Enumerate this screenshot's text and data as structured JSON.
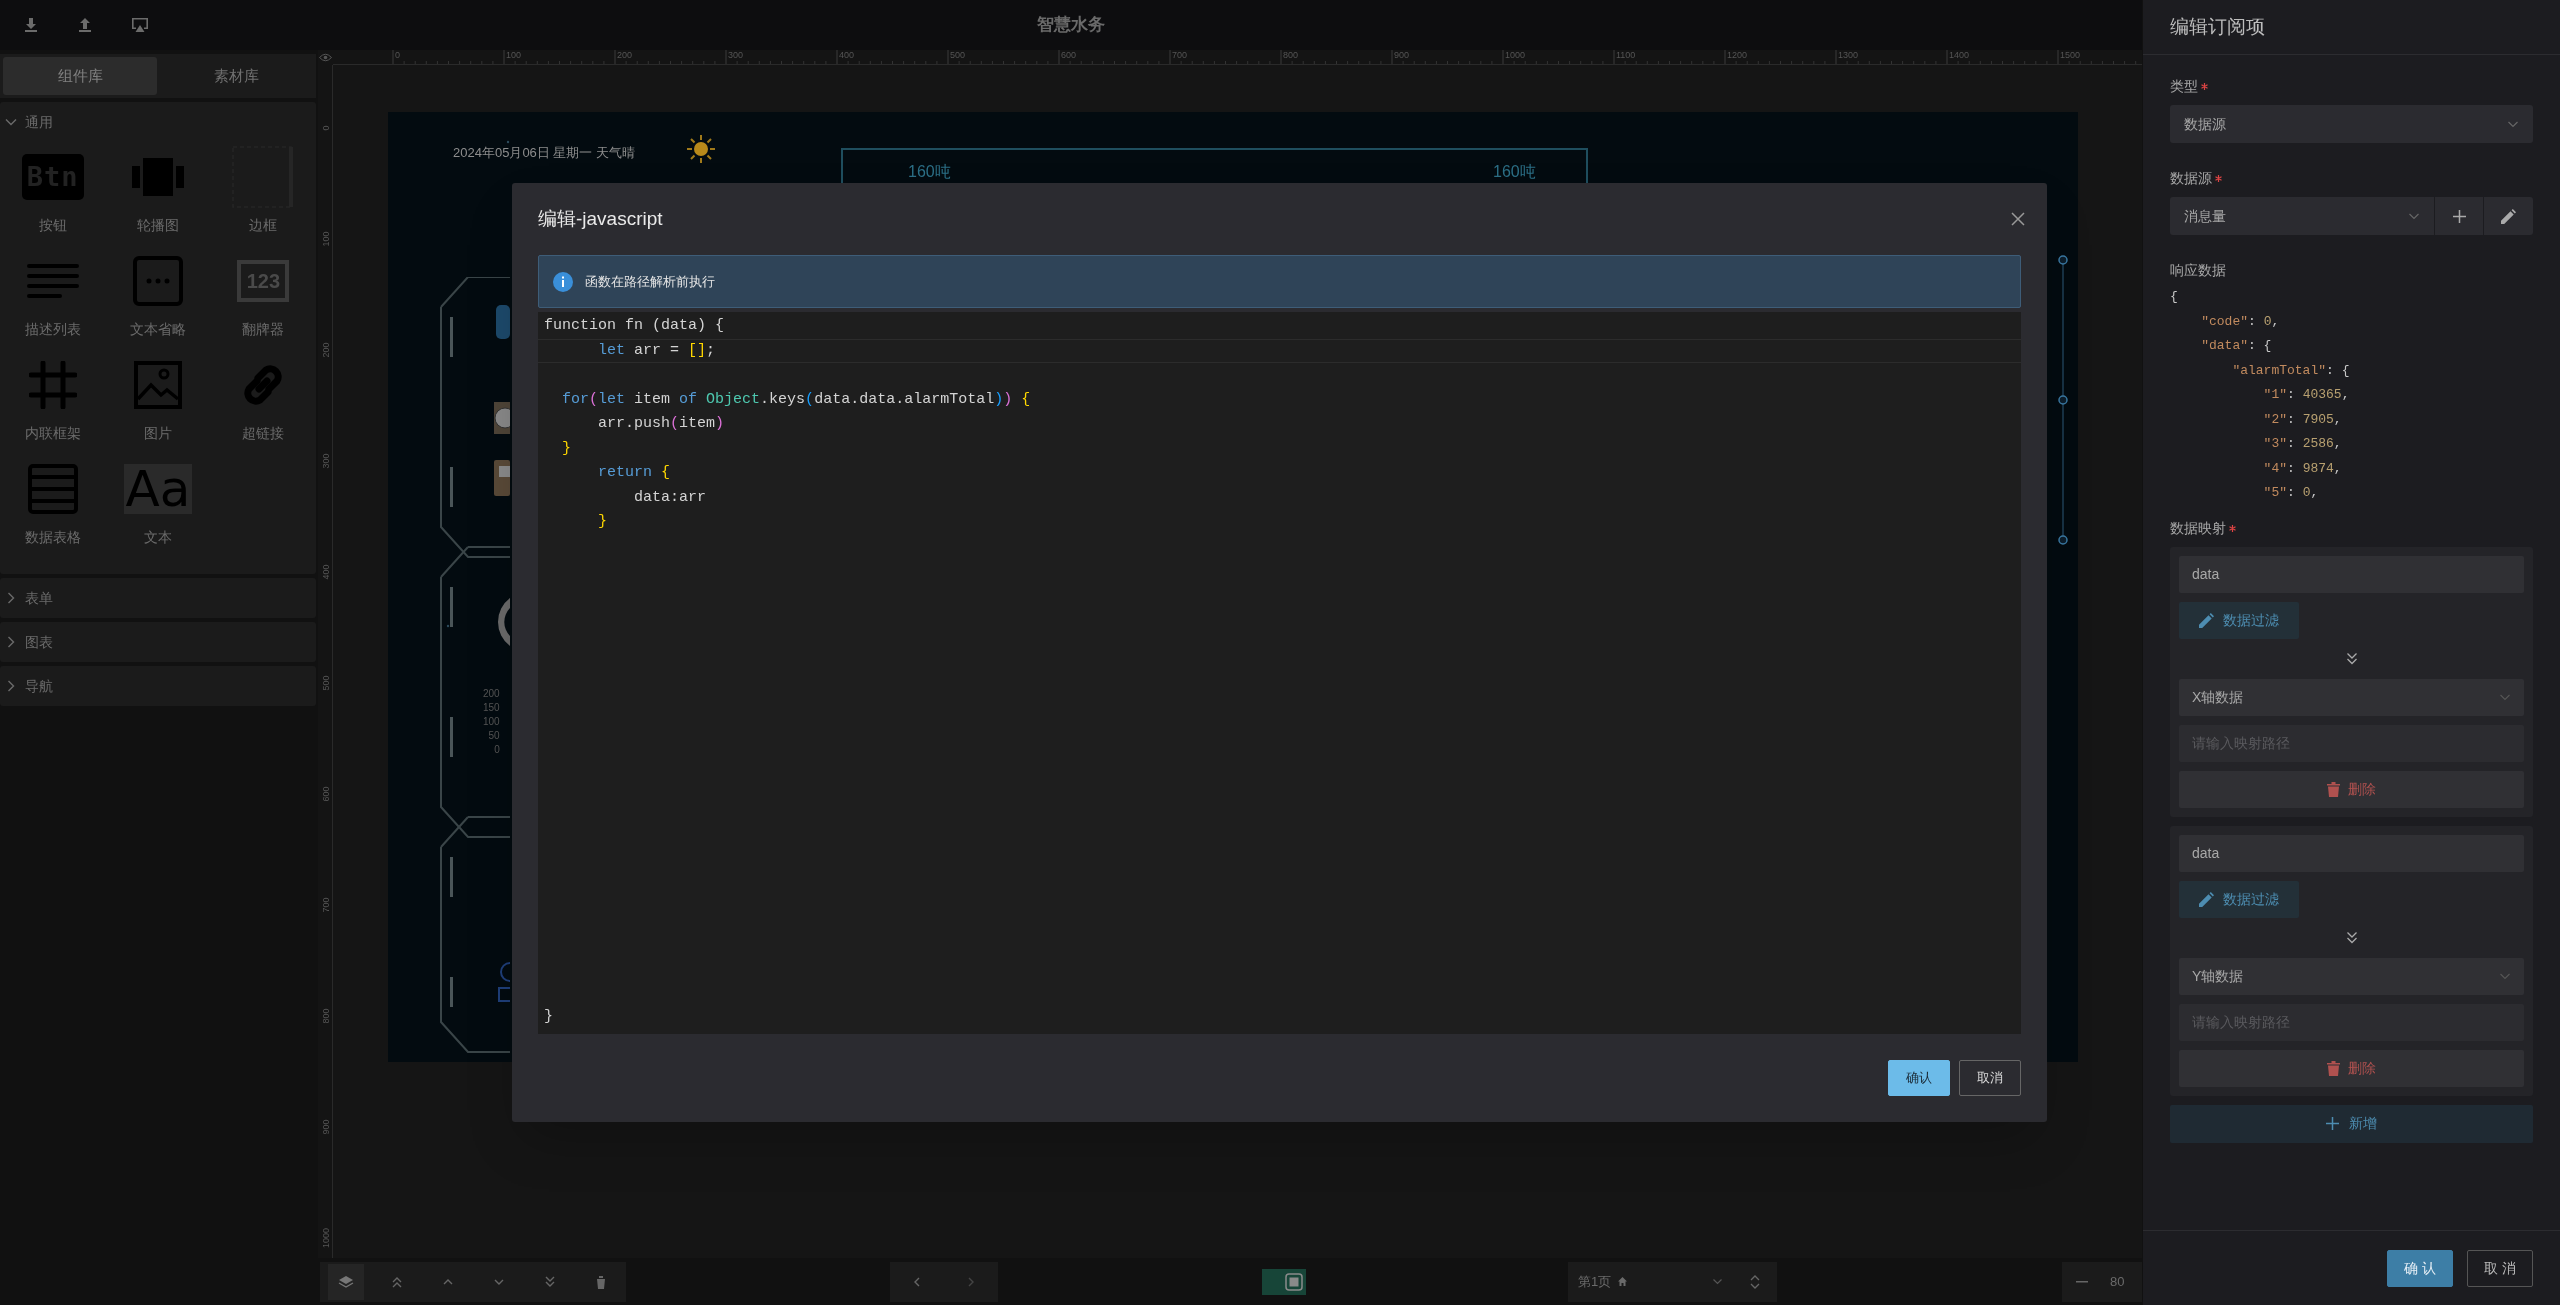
{
  "top_bar": {
    "title": "智慧水务"
  },
  "left_panel": {
    "tabs": [
      {
        "label": "组件库",
        "selected": true
      },
      {
        "label": "素材库",
        "selected": false
      }
    ],
    "groups": [
      {
        "label": "通用",
        "expanded": true,
        "items": [
          {
            "label": "按钮",
            "icon_text": "Btn"
          },
          {
            "label": "轮播图"
          },
          {
            "label": "边框"
          },
          {
            "label": "描述列表"
          },
          {
            "label": "文本省略"
          },
          {
            "label": "翻牌器",
            "icon_text": "123"
          },
          {
            "label": "内联框架"
          },
          {
            "label": "图片"
          },
          {
            "label": "超链接"
          },
          {
            "label": "数据表格"
          },
          {
            "label": "文本",
            "icon_text": "Aa"
          }
        ]
      },
      {
        "label": "表单",
        "expanded": false
      },
      {
        "label": "图表",
        "expanded": false
      },
      {
        "label": "导航",
        "expanded": false
      }
    ]
  },
  "rulers": {
    "horizontal": [
      "0",
      "100",
      "200",
      "300",
      "400",
      "500",
      "600",
      "700",
      "800",
      "900",
      "1000",
      "1100",
      "1200",
      "1300",
      "1400",
      "1500"
    ],
    "vertical": [
      "0",
      "100",
      "200",
      "300",
      "400",
      "500",
      "600",
      "700",
      "800",
      "900",
      "1000"
    ]
  },
  "canvas": {
    "date": "2024年05月06日 星期一 天气晴",
    "badges": [
      "160吨",
      "160吨"
    ],
    "axis_ticks": [
      "200",
      "150",
      "100",
      "50",
      "0"
    ]
  },
  "bottom_bar": {
    "page": "第1页",
    "zoom": "80"
  },
  "modal": {
    "title": "编辑-javascript",
    "info": "函数在路径解析前执行",
    "code": [
      {
        "kind": "code",
        "tokens": [
          {
            "text": "function fn (data) {",
            "kind": "plain"
          }
        ]
      },
      {
        "kind": "code",
        "tokens": [
          {
            "text": "      let",
            "kind": "keyword"
          },
          {
            "text": " arr = ",
            "kind": "plain"
          },
          {
            "text": "[]",
            "kind": "bracket1"
          },
          {
            "text": ";",
            "kind": "plain"
          }
        ]
      },
      {
        "kind": "blank"
      },
      {
        "kind": "code",
        "tokens": [
          {
            "text": "  for",
            "kind": "keyword"
          },
          {
            "text": "(",
            "kind": "bracket2"
          },
          {
            "text": "let",
            "kind": "keyword"
          },
          {
            "text": " item ",
            "kind": "plain"
          },
          {
            "text": "of",
            "kind": "keyword"
          },
          {
            "text": " Object",
            "kind": "class"
          },
          {
            "text": ".keys",
            "kind": "plain"
          },
          {
            "text": "(",
            "kind": "bracket3"
          },
          {
            "text": "data.data.alarmTotal",
            "kind": "plain"
          },
          {
            "text": ")",
            "kind": "bracket3"
          },
          {
            "text": ")",
            "kind": "bracket2"
          },
          {
            "text": " {",
            "kind": "bracket1"
          }
        ]
      },
      {
        "kind": "code",
        "tokens": [
          {
            "text": "      arr.push",
            "kind": "plain"
          },
          {
            "text": "(",
            "kind": "bracket2"
          },
          {
            "text": "item",
            "kind": "plain"
          },
          {
            "text": ")",
            "kind": "bracket2"
          }
        ]
      },
      {
        "kind": "code",
        "tokens": [
          {
            "text": "  }",
            "kind": "bracket1"
          }
        ]
      },
      {
        "kind": "code",
        "tokens": [
          {
            "text": "      return",
            "kind": "keyword"
          },
          {
            "text": " {",
            "kind": "bracket1"
          }
        ]
      },
      {
        "kind": "code",
        "tokens": [
          {
            "text": "          data:arr",
            "kind": "plain"
          }
        ]
      },
      {
        "kind": "code",
        "tokens": [
          {
            "text": "      }",
            "kind": "bracket1"
          }
        ]
      }
    ],
    "closing": "}",
    "buttons": [
      {
        "label": "确认",
        "kind": "primary"
      },
      {
        "label": "取消",
        "kind": "default"
      }
    ]
  },
  "right_panel": {
    "title": "编辑订阅项",
    "type_field": {
      "label": "类型",
      "required": true,
      "value": "数据源"
    },
    "source_field": {
      "label": "数据源",
      "required": true,
      "value": "消息量"
    },
    "response": {
      "label": "响应数据",
      "lines": [
        [
          {
            "text": "{",
            "kind": "punct"
          }
        ],
        [
          {
            "text": "    \"code\"",
            "kind": "string"
          },
          {
            "text": ": ",
            "kind": "punct"
          },
          {
            "text": "0",
            "kind": "number"
          },
          {
            "text": ",",
            "kind": "punct"
          }
        ],
        [
          {
            "text": "    \"data\"",
            "kind": "string"
          },
          {
            "text": ": {",
            "kind": "punct"
          }
        ],
        [
          {
            "text": "        \"alarmTotal\"",
            "kind": "string"
          },
          {
            "text": ": {",
            "kind": "punct"
          }
        ],
        [
          {
            "text": "            \"1\"",
            "kind": "string"
          },
          {
            "text": ": ",
            "kind": "punct"
          },
          {
            "text": "40365",
            "kind": "number"
          },
          {
            "text": ",",
            "kind": "punct"
          }
        ],
        [
          {
            "text": "            \"2\"",
            "kind": "string"
          },
          {
            "text": ": ",
            "kind": "punct"
          },
          {
            "text": "7905",
            "kind": "number"
          },
          {
            "text": ",",
            "kind": "punct"
          }
        ],
        [
          {
            "text": "            \"3\"",
            "kind": "string"
          },
          {
            "text": ": ",
            "kind": "punct"
          },
          {
            "text": "2586",
            "kind": "number"
          },
          {
            "text": ",",
            "kind": "punct"
          }
        ],
        [
          {
            "text": "            \"4\"",
            "kind": "string"
          },
          {
            "text": ": ",
            "kind": "punct"
          },
          {
            "text": "9874",
            "kind": "number"
          },
          {
            "text": ",",
            "kind": "punct"
          }
        ],
        [
          {
            "text": "            \"5\"",
            "kind": "string"
          },
          {
            "text": ": ",
            "kind": "punct"
          },
          {
            "text": "0",
            "kind": "number"
          },
          {
            "text": ",",
            "kind": "punct"
          }
        ]
      ]
    },
    "mapping": {
      "label": "数据映射",
      "required": true,
      "cards": [
        {
          "path": "data",
          "filter": "数据过滤",
          "axis": "X轴数据",
          "placeholder": "请输入映射路径",
          "delete": "删除"
        },
        {
          "path": "data",
          "filter": "数据过滤",
          "axis": "Y轴数据",
          "placeholder": "请输入映射路径",
          "delete": "删除"
        }
      ],
      "add": "新增"
    },
    "buttons": [
      {
        "label": "确 认",
        "kind": "primary"
      },
      {
        "label": "取 消",
        "kind": "default"
      }
    ]
  }
}
